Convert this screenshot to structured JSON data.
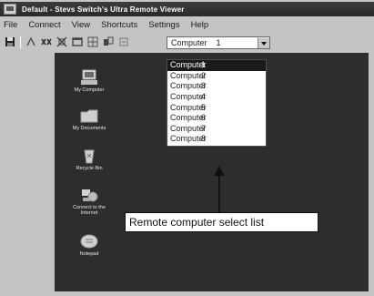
{
  "window": {
    "title": "Default - Stevs Switch's Ultra Remote Viewer"
  },
  "menu": {
    "items": [
      {
        "label": "File"
      },
      {
        "label": "Connect"
      },
      {
        "label": "View"
      },
      {
        "label": "Shortcuts"
      },
      {
        "label": "Settings"
      },
      {
        "label": "Help"
      }
    ]
  },
  "toolbar": {
    "buttons": [
      "save-icon",
      "connect-icon",
      "disconnect-icon",
      "fullscreen-icon",
      "window-icon",
      "grid-icon",
      "transfer-icon",
      "refresh-icon"
    ],
    "computer_select": {
      "name": "Computer",
      "number": "1"
    }
  },
  "dropdown": {
    "options": [
      {
        "name": "Computer",
        "number": "1",
        "selected": true
      },
      {
        "name": "Computer",
        "number": "2"
      },
      {
        "name": "Computer",
        "number": "3"
      },
      {
        "name": "Computer",
        "number": "4"
      },
      {
        "name": "Computer",
        "number": "5"
      },
      {
        "name": "Computer",
        "number": "6"
      },
      {
        "name": "Computer",
        "number": "7"
      },
      {
        "name": "Computer",
        "number": "8"
      }
    ]
  },
  "desktop": {
    "icons": [
      {
        "label": "My Computer",
        "icon": "computer-icon"
      },
      {
        "label": "My Documents",
        "icon": "folder-icon"
      },
      {
        "label": "Recycle Bin",
        "icon": "recycle-bin-icon"
      },
      {
        "label_line1": "Connect to the",
        "label_line2": "Internet",
        "icon": "internet-icon"
      },
      {
        "label": "Notepad",
        "icon": "notepad-icon"
      }
    ]
  },
  "callout": {
    "text": "Remote computer select list"
  },
  "colors": {
    "desktop": "#2d2d2d",
    "chrome": "#c4c4c4",
    "selection": "#1a1a1a"
  }
}
